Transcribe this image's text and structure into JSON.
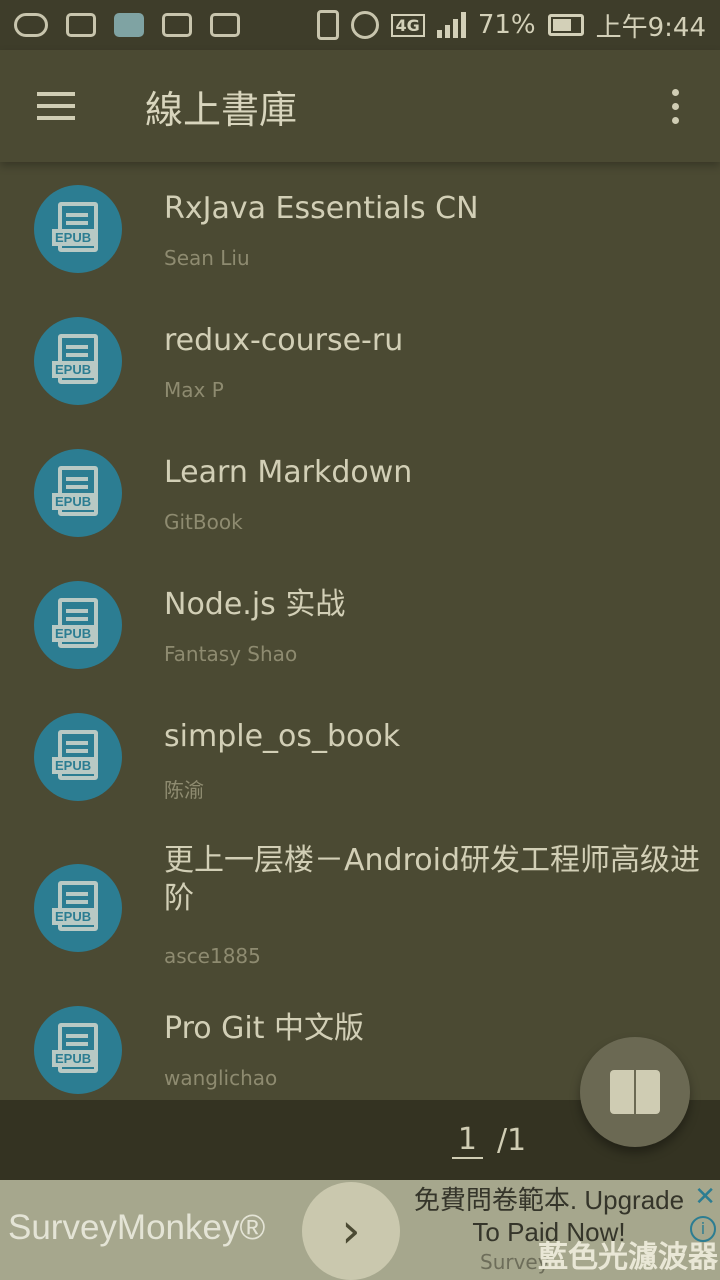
{
  "status_bar": {
    "battery": "71%",
    "network": "4G",
    "time": "上午9:44"
  },
  "app_bar": {
    "title": "線上書庫"
  },
  "books": [
    {
      "title": "RxJava Essentials CN",
      "author": "Sean Liu",
      "badge": "EPUB"
    },
    {
      "title": "redux-course-ru",
      "author": "Max P",
      "badge": "EPUB"
    },
    {
      "title": "Learn Markdown",
      "author": "GitBook",
      "badge": "EPUB"
    },
    {
      "title": "Node.js 实战",
      "author": "Fantasy Shao",
      "badge": "EPUB"
    },
    {
      "title": "simple_os_book",
      "author": "陈渝",
      "badge": "EPUB"
    },
    {
      "title": "更上一层楼－Android研发工程师高级进阶",
      "author": "asce1885",
      "badge": "EPUB"
    },
    {
      "title": "Pro Git 中文版",
      "author": "wanglichao",
      "badge": "EPUB"
    }
  ],
  "pagination": {
    "current": "1",
    "total": "/1"
  },
  "ad": {
    "brand": "SurveyMonkey®",
    "headline": "免費問卷範本. Upgrade To Paid Now!",
    "source": "Survey",
    "watermark": "藍色光濾波器"
  },
  "icons": {
    "menu": "hamburger-icon",
    "more": "more-vert-icon",
    "fab": "open-book-icon"
  }
}
